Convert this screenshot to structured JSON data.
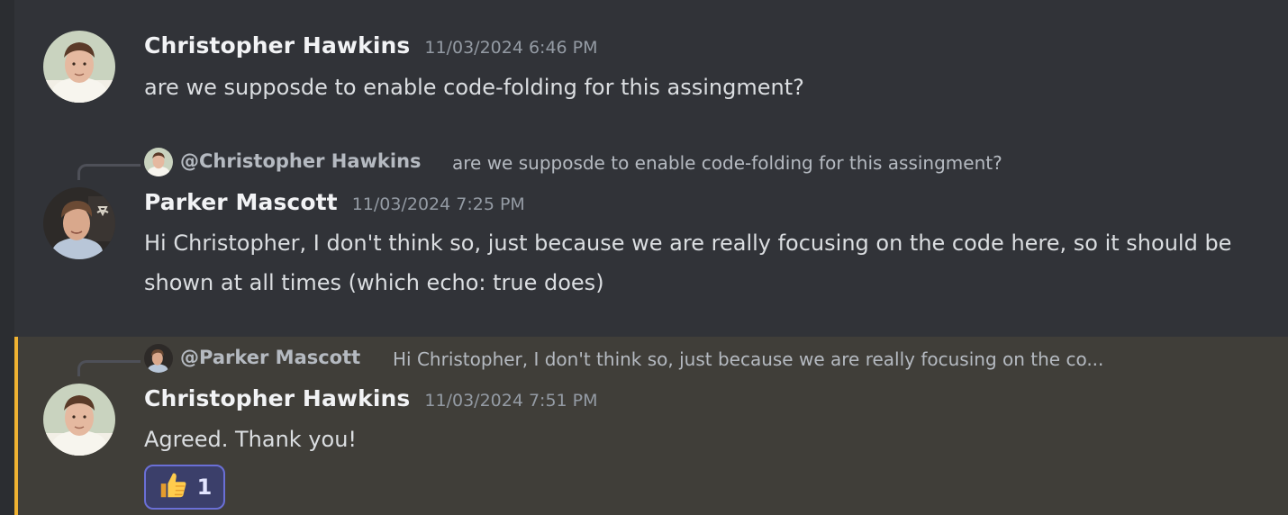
{
  "messages": [
    {
      "author": "Christopher Hawkins",
      "timestamp": "11/03/2024 6:46 PM",
      "content": "are we supposde to enable code-folding for this assingment?"
    },
    {
      "reply": {
        "mention": "@Christopher Hawkins",
        "text": "are we supposde to enable code-folding for this assingment?"
      },
      "author": "Parker Mascott",
      "timestamp": "11/03/2024 7:25 PM",
      "content": "Hi Christopher, I don't think so, just because we are really focusing on the code here, so it should be shown at all times (which echo: true does)"
    },
    {
      "reply": {
        "mention": "@Parker Mascott",
        "text": "Hi Christopher, I don't think so, just because we are really focusing on the co..."
      },
      "author": "Christopher Hawkins",
      "timestamp": "11/03/2024 7:51 PM",
      "content": "Agreed. Thank you!",
      "reaction": {
        "emoji": "thumbs-up-icon",
        "count": "1"
      }
    }
  ],
  "colors": {
    "background": "#313338",
    "highlight_background": "#403e39",
    "mention_bar": "#f0b232",
    "reaction_border": "#6a6fd6"
  }
}
